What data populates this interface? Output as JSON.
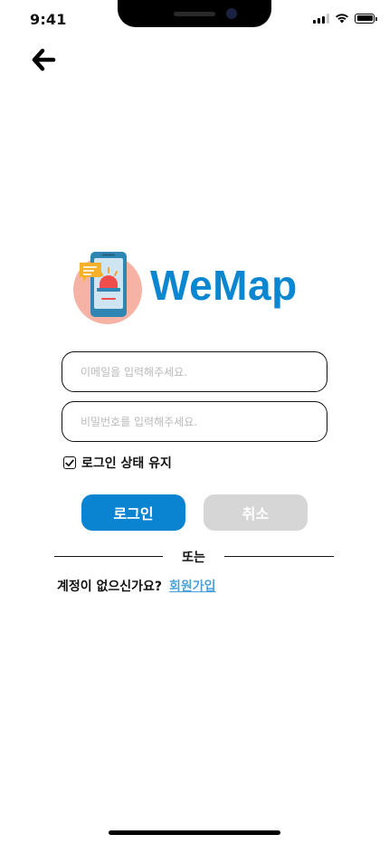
{
  "status_bar": {
    "time": "9:41"
  },
  "header": {
    "back_icon": "arrow-left-icon"
  },
  "logo": {
    "text": "WeMap",
    "brand_color": "#0b86d0",
    "icon": "phone-siren-icon"
  },
  "form": {
    "email_placeholder": "이메일을 입력해주세요.",
    "email_value": "",
    "password_placeholder": "비밀번호를 입력해주세요.",
    "password_value": "",
    "remember_label": "로그인 상태 유지",
    "remember_checked": true,
    "login_label": "로그인",
    "cancel_label": "취소",
    "login_color": "#0a84d0",
    "cancel_color": "#d6d6d6"
  },
  "divider": {
    "text": "또는"
  },
  "signup": {
    "prompt": "계정이 없으신가요?",
    "link": "회원가입",
    "link_color": "#4ea1d8"
  }
}
